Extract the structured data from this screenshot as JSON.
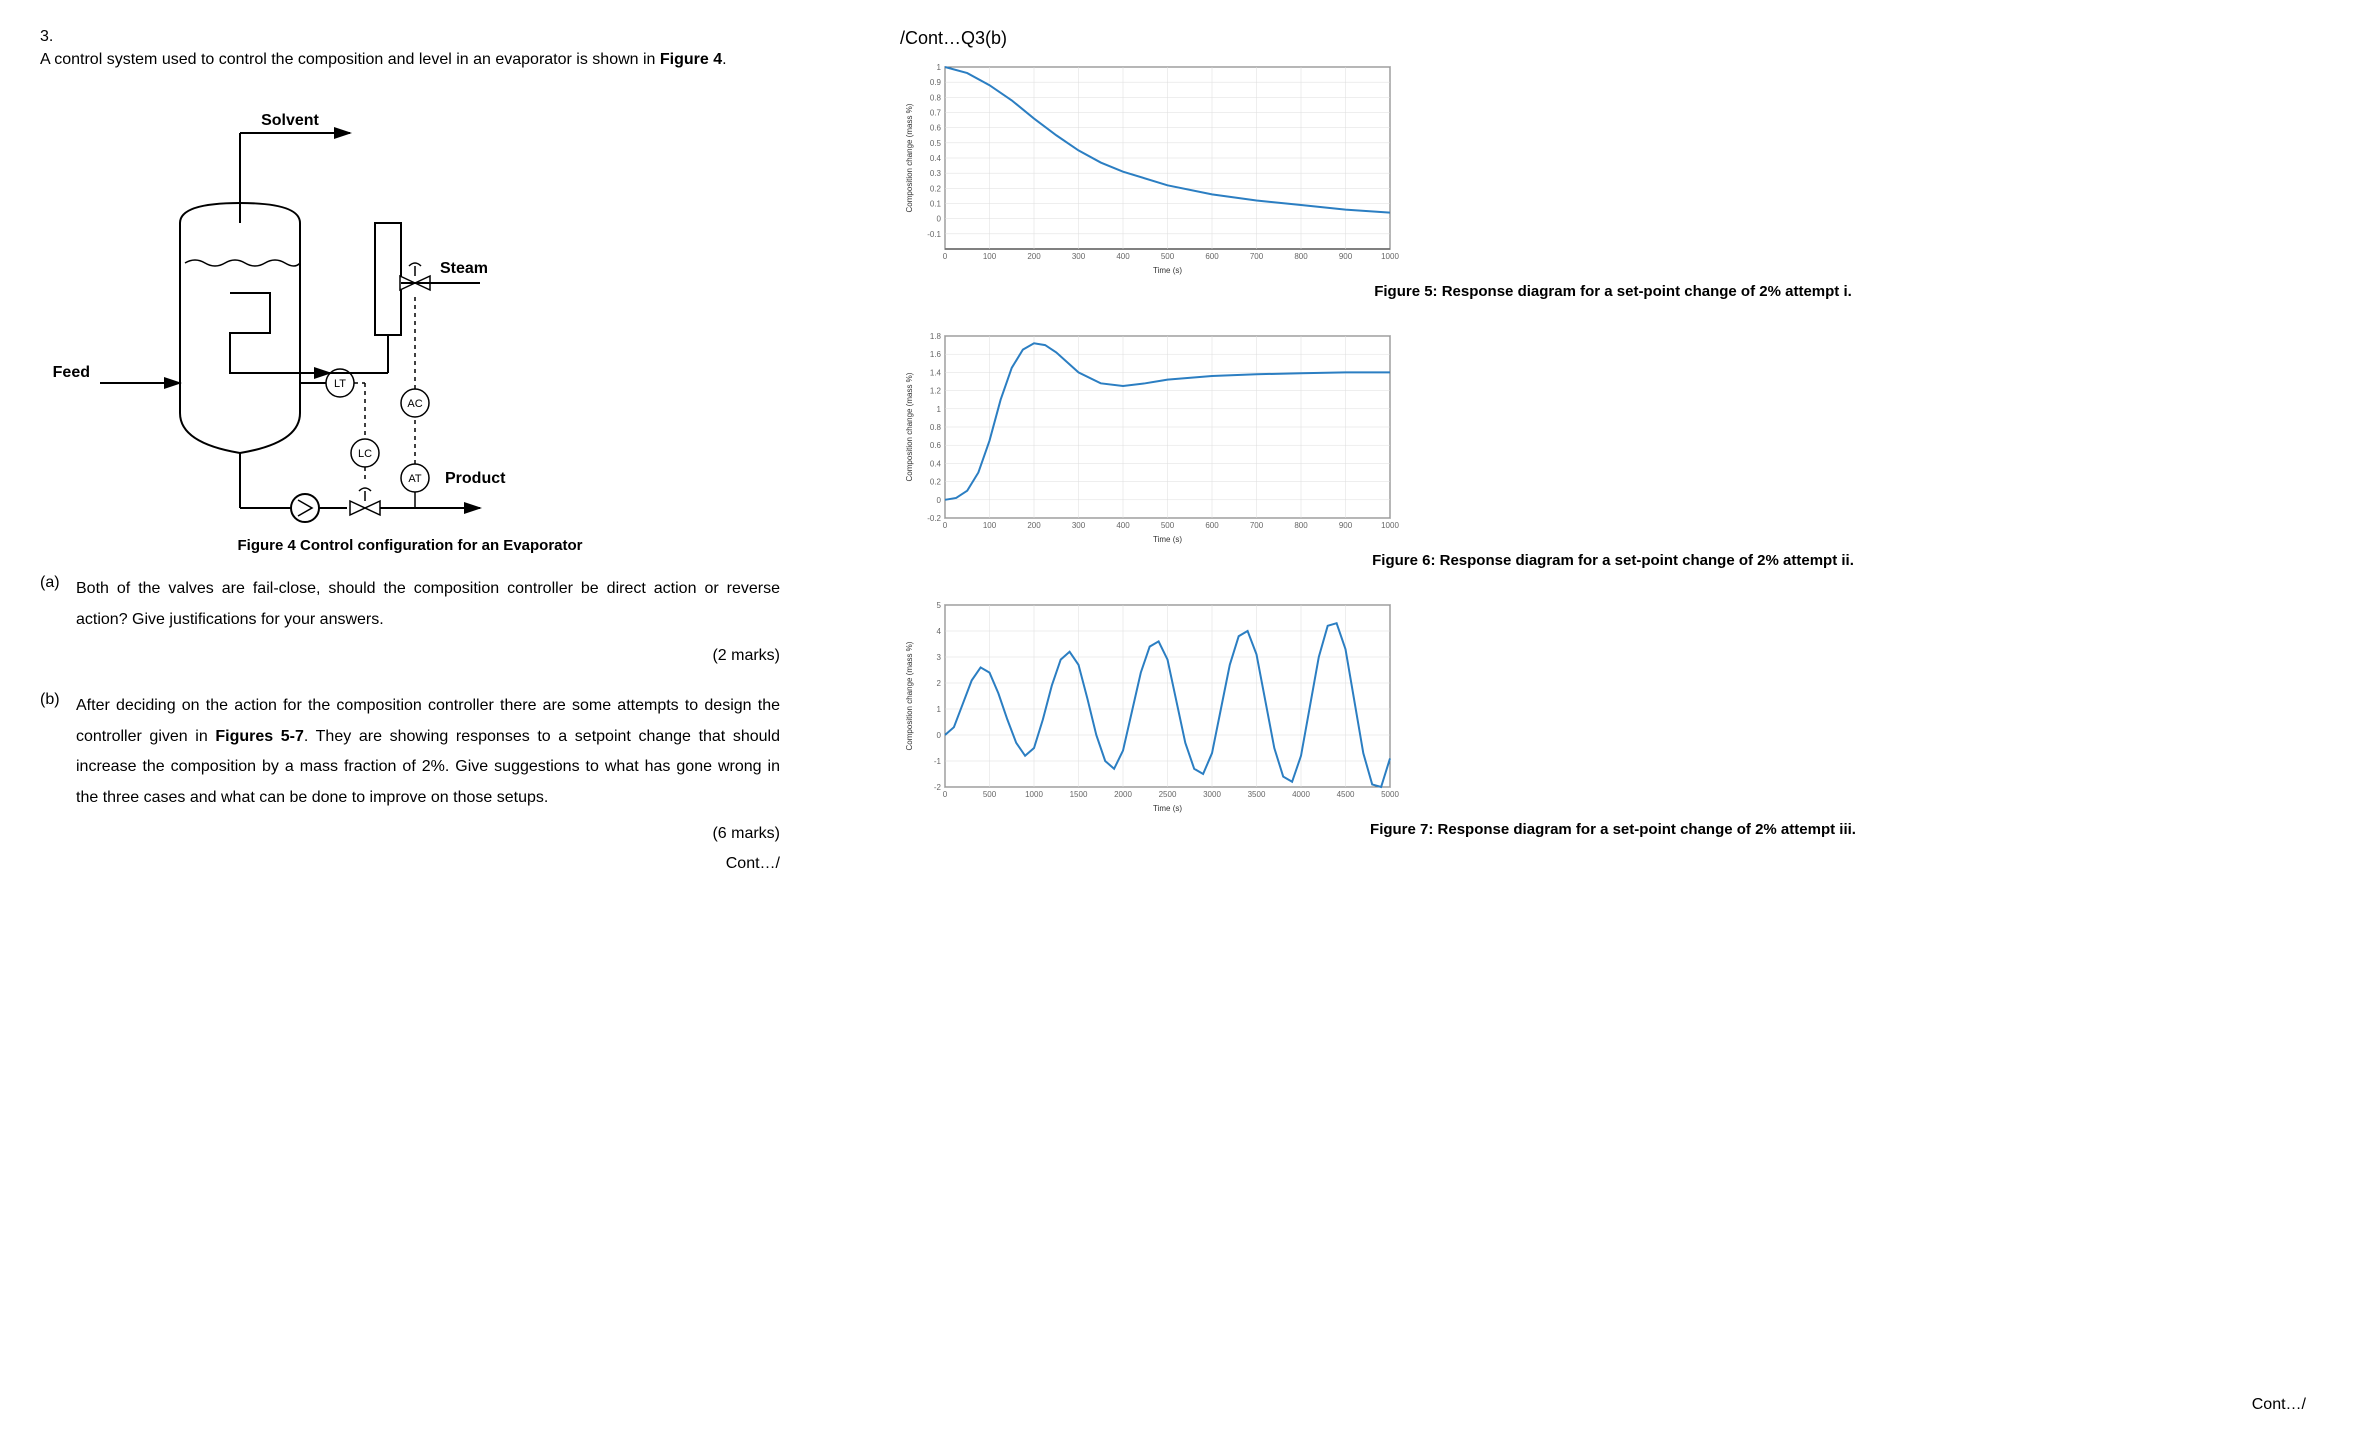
{
  "question": {
    "number": "3.",
    "intro_pre": "A control system used to control the composition and level in an evaporator is shown in ",
    "intro_figref": "Figure 4",
    "intro_post": ".",
    "diagram": {
      "labels": {
        "solvent": "Solvent",
        "steam": "Steam",
        "feed": "Feed",
        "product": "Product",
        "LT": "LT",
        "AC": "AC",
        "LC": "LC",
        "AT": "AT"
      },
      "caption": "Figure 4  Control configuration for an Evaporator"
    },
    "parts": {
      "a": {
        "label": "(a)",
        "text": "Both of the valves are fail-close, should the composition controller be direct action or reverse action?  Give justifications for your answers.",
        "marks": "(2 marks)"
      },
      "b": {
        "label": "(b)",
        "text_pre": "After deciding on the action for the composition controller there are some attempts to design the controller given in ",
        "text_ref": "Figures 5-7",
        "text_post": ".   They are showing responses to a setpoint change that should increase the composition by a mass fraction of 2%.  Give suggestions to what has gone wrong in the three cases and what can be done to improve on those setups.",
        "marks": "(6 marks)"
      }
    },
    "cont": "Cont…/"
  },
  "right": {
    "header": "/Cont…Q3(b)",
    "fig5_caption": "Figure 5:  Response diagram for a set-point change of 2% attempt i.",
    "fig6_caption": "Figure 6:  Response diagram for a set-point change of 2% attempt ii.",
    "fig7_caption": "Figure 7:  Response diagram for a set-point change of 2% attempt iii.",
    "cont": "Cont…/"
  },
  "chart_data": [
    {
      "id": "fig5",
      "type": "line",
      "title": "",
      "xlabel": "Time (s)",
      "ylabel": "Composition change (mass %)",
      "xlim": [
        0,
        1000
      ],
      "ylim": [
        -0.2,
        1.0
      ],
      "xticks": [
        0,
        100,
        200,
        300,
        400,
        500,
        600,
        700,
        800,
        900,
        1000
      ],
      "yticks": [
        -0.1,
        0.0,
        0.1,
        0.2,
        0.3,
        0.4,
        0.5,
        0.6,
        0.7,
        0.8,
        0.9,
        1.0
      ],
      "series": [
        {
          "name": "response",
          "x": [
            0,
            50,
            100,
            150,
            200,
            250,
            300,
            350,
            400,
            500,
            600,
            700,
            800,
            900,
            1000
          ],
          "y": [
            1.0,
            0.96,
            0.88,
            0.78,
            0.66,
            0.55,
            0.45,
            0.37,
            0.31,
            0.22,
            0.16,
            0.12,
            0.09,
            0.06,
            0.04
          ]
        }
      ]
    },
    {
      "id": "fig6",
      "type": "line",
      "title": "",
      "xlabel": "Time (s)",
      "ylabel": "Composition change (mass %)",
      "xlim": [
        0,
        1000
      ],
      "ylim": [
        -0.2,
        1.8
      ],
      "xticks": [
        0,
        100,
        200,
        300,
        400,
        500,
        600,
        700,
        800,
        900,
        1000
      ],
      "yticks": [
        -0.2,
        0.0,
        0.2,
        0.4,
        0.6,
        0.8,
        1.0,
        1.2,
        1.4,
        1.6,
        1.8
      ],
      "series": [
        {
          "name": "response",
          "x": [
            0,
            25,
            50,
            75,
            100,
            125,
            150,
            175,
            200,
            225,
            250,
            300,
            350,
            400,
            450,
            500,
            600,
            700,
            800,
            900,
            1000
          ],
          "y": [
            0.0,
            0.02,
            0.1,
            0.3,
            0.65,
            1.1,
            1.45,
            1.65,
            1.72,
            1.7,
            1.62,
            1.4,
            1.28,
            1.25,
            1.28,
            1.32,
            1.36,
            1.38,
            1.39,
            1.4,
            1.4
          ]
        }
      ]
    },
    {
      "id": "fig7",
      "type": "line",
      "title": "",
      "xlabel": "Time (s)",
      "ylabel": "Composition change (mass %)",
      "xlim": [
        0,
        5000
      ],
      "ylim": [
        -2,
        5
      ],
      "xticks": [
        0,
        500,
        1000,
        1500,
        2000,
        2500,
        3000,
        3500,
        4000,
        4500,
        5000
      ],
      "yticks": [
        -2,
        -1,
        0,
        1,
        2,
        3,
        4,
        5
      ],
      "series": [
        {
          "name": "response",
          "x": [
            0,
            100,
            200,
            300,
            400,
            500,
            600,
            700,
            800,
            900,
            1000,
            1100,
            1200,
            1300,
            1400,
            1500,
            1600,
            1700,
            1800,
            1900,
            2000,
            2100,
            2200,
            2300,
            2400,
            2500,
            2600,
            2700,
            2800,
            2900,
            3000,
            3100,
            3200,
            3300,
            3400,
            3500,
            3600,
            3700,
            3800,
            3900,
            4000,
            4100,
            4200,
            4300,
            4400,
            4500,
            4600,
            4700,
            4800,
            4900,
            5000
          ],
          "y": [
            0.0,
            0.3,
            1.2,
            2.1,
            2.6,
            2.4,
            1.6,
            0.6,
            -0.3,
            -0.8,
            -0.5,
            0.6,
            1.9,
            2.9,
            3.2,
            2.7,
            1.4,
            0.0,
            -1.0,
            -1.3,
            -0.6,
            0.9,
            2.4,
            3.4,
            3.6,
            2.9,
            1.3,
            -0.3,
            -1.3,
            -1.5,
            -0.7,
            1.0,
            2.7,
            3.8,
            4.0,
            3.1,
            1.3,
            -0.5,
            -1.6,
            -1.8,
            -0.8,
            1.1,
            3.0,
            4.2,
            4.3,
            3.3,
            1.3,
            -0.7,
            -1.9,
            -2.0,
            -0.9
          ]
        }
      ]
    }
  ]
}
